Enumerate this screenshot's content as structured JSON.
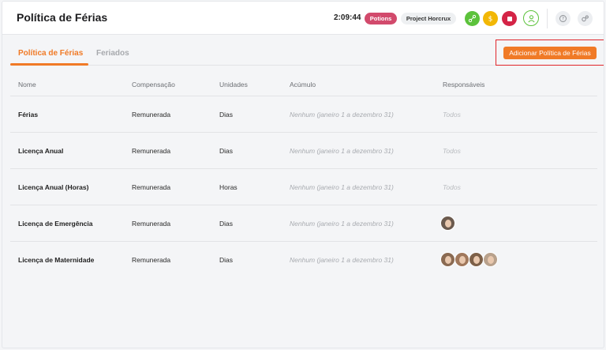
{
  "header": {
    "title": "Política de Férias",
    "timer": "2:09:44",
    "tags": [
      "Potions",
      "Project Horcrux"
    ]
  },
  "tabs": [
    {
      "label": "Política de Férias",
      "active": true
    },
    {
      "label": "Feriados",
      "active": false
    }
  ],
  "actions": {
    "add_label": "Adicionar Política de Férias"
  },
  "table": {
    "headers": [
      "Nome",
      "Compensação",
      "Unidades",
      "Acúmulo",
      "Responsáveis"
    ],
    "rows": [
      {
        "name": "Férias",
        "comp": "Remunerada",
        "units": "Dias",
        "accrual": "Nenhum (janeiro 1 a dezembro 31)",
        "resp": "Todos",
        "avatars": []
      },
      {
        "name": "Licença Anual",
        "comp": "Remunerada",
        "units": "Dias",
        "accrual": "Nenhum (janeiro 1 a dezembro 31)",
        "resp": "Todos",
        "avatars": []
      },
      {
        "name": "Licença Anual (Horas)",
        "comp": "Remunerada",
        "units": "Horas",
        "accrual": "Nenhum (janeiro 1 a dezembro 31)",
        "resp": "Todos",
        "avatars": []
      },
      {
        "name": "Licença de Emergência",
        "comp": "Remunerada",
        "units": "Dias",
        "accrual": "Nenhum (janeiro 1 a dezembro 31)",
        "resp": "",
        "avatars": [
          "#6b5a4e"
        ]
      },
      {
        "name": "Licença de Maternidade",
        "comp": "Remunerada",
        "units": "Dias",
        "accrual": "Nenhum (janeiro 1 a dezembro 31)",
        "resp": "",
        "avatars": [
          "#8a6a52",
          "#a0785c",
          "#7d6048",
          "#b8a18c"
        ]
      }
    ]
  },
  "colors": {
    "accent": "#f07a26",
    "potions": "#d24a6c",
    "highlight": "#e0252b"
  },
  "icons": [
    "project-icon",
    "coin-icon",
    "stop-icon",
    "user-icon",
    "help-icon",
    "settings-icon"
  ]
}
